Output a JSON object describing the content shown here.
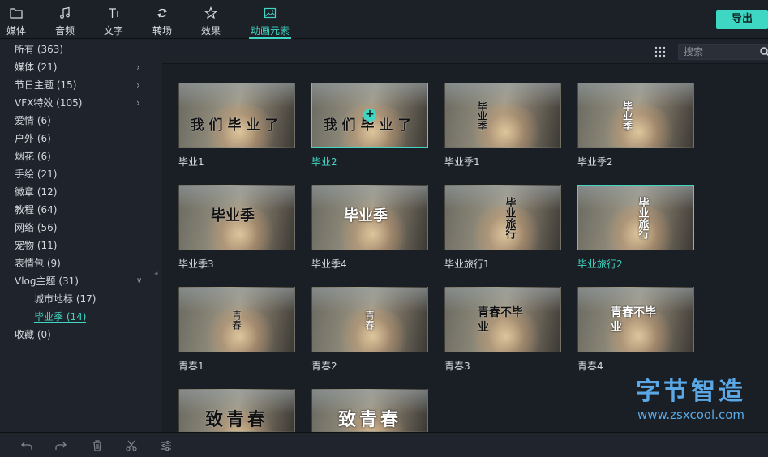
{
  "tabs": [
    {
      "label": "媒体",
      "icon": "folder-icon"
    },
    {
      "label": "音频",
      "icon": "music-note-icon"
    },
    {
      "label": "文字",
      "icon": "text-icon"
    },
    {
      "label": "转场",
      "icon": "transition-icon"
    },
    {
      "label": "效果",
      "icon": "effects-icon"
    },
    {
      "label": "动画元素",
      "icon": "image-icon",
      "active": true
    }
  ],
  "export_label": "导出",
  "categories": [
    {
      "label": "所有 (363)"
    },
    {
      "label": "媒体 (21)",
      "expandable": true
    },
    {
      "label": "节日主题 (15)",
      "expandable": true
    },
    {
      "label": "VFX特效 (105)",
      "expandable": true
    },
    {
      "label": "爱情 (6)"
    },
    {
      "label": "户外 (6)"
    },
    {
      "label": "烟花 (6)"
    },
    {
      "label": "手绘 (21)"
    },
    {
      "label": "徽章 (12)"
    },
    {
      "label": "教程 (64)"
    },
    {
      "label": "网络 (56)"
    },
    {
      "label": "宠物 (11)"
    },
    {
      "label": "表情包 (9)"
    },
    {
      "label": "Vlog主题 (31)",
      "expanded": true
    },
    {
      "label": "城市地标 (17)",
      "sub": true
    },
    {
      "label": "毕业季 (14)",
      "sub": true,
      "selected": true
    },
    {
      "label": "收藏 (0)"
    }
  ],
  "search": {
    "placeholder": "搜索"
  },
  "elements": [
    {
      "name": "毕业1",
      "overlay": "我们毕业了"
    },
    {
      "name": "毕业2",
      "overlay": "我们毕业了",
      "selected": true
    },
    {
      "name": "毕业季1",
      "overlay": "毕业季"
    },
    {
      "name": "毕业季2",
      "overlay": "毕业季"
    },
    {
      "name": "毕业季3",
      "overlay": "毕业季"
    },
    {
      "name": "毕业季4",
      "overlay": "毕业季"
    },
    {
      "name": "毕业旅行1",
      "overlay": "毕业旅行"
    },
    {
      "name": "毕业旅行2",
      "overlay": "毕业旅行",
      "selected": true
    },
    {
      "name": "青春1",
      "overlay": "青春"
    },
    {
      "name": "青春2",
      "overlay": "青春"
    },
    {
      "name": "青春3",
      "overlay": "青春不毕业"
    },
    {
      "name": "青春4",
      "overlay": "青春不毕业"
    },
    {
      "name": "",
      "overlay": "致青春"
    },
    {
      "name": "",
      "overlay": "致青春"
    }
  ],
  "watermark": {
    "title": "字节智造",
    "url": "www.zsxcool.com"
  },
  "bottom_tools": [
    "undo-icon",
    "redo-icon",
    "delete-icon",
    "cut-icon",
    "adjust-icon"
  ],
  "colors": {
    "accent": "#41d6c3",
    "export": "#3dd7c4",
    "watermark": "#5aa9e6",
    "background": "#1a1e25"
  }
}
